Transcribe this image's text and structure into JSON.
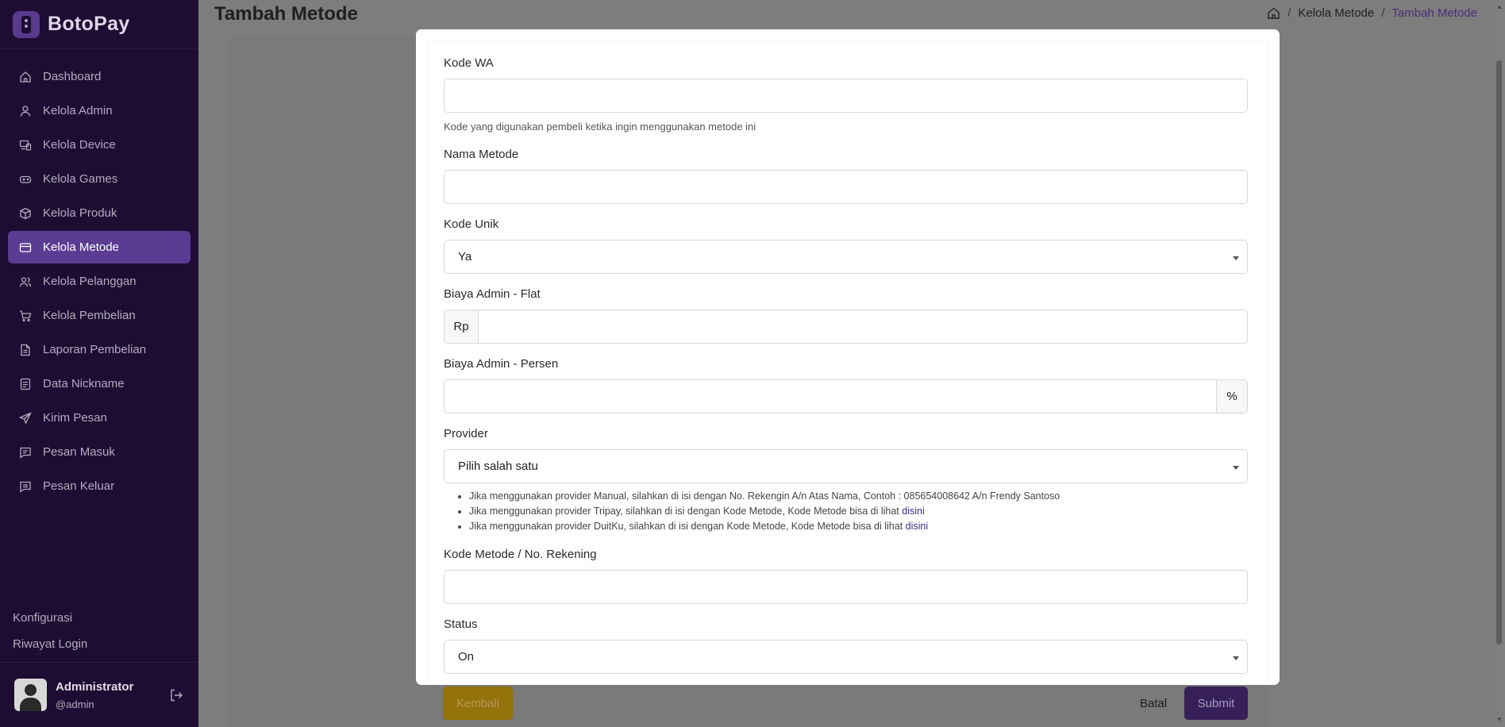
{
  "sidebar": {
    "brand": "BotoPay",
    "items": [
      {
        "label": "Dashboard",
        "icon": "home-icon"
      },
      {
        "label": "Kelola Admin",
        "icon": "user-icon"
      },
      {
        "label": "Kelola Device",
        "icon": "devices-icon"
      },
      {
        "label": "Kelola Games",
        "icon": "gamepad-icon"
      },
      {
        "label": "Kelola Produk",
        "icon": "box-icon"
      },
      {
        "label": "Kelola Metode",
        "icon": "credit-card-icon",
        "active": true
      },
      {
        "label": "Kelola Pelanggan",
        "icon": "users-icon"
      },
      {
        "label": "Kelola Pembelian",
        "icon": "cart-icon"
      },
      {
        "label": "Laporan Pembelian",
        "icon": "file-text-icon"
      },
      {
        "label": "Data Nickname",
        "icon": "database-icon"
      },
      {
        "label": "Kirim Pesan",
        "icon": "send-icon"
      },
      {
        "label": "Pesan Masuk",
        "icon": "message-icon"
      },
      {
        "label": "Pesan Keluar",
        "icon": "message-out-icon"
      }
    ],
    "bottom_links": [
      "Konfigurasi",
      "Riwayat Login"
    ],
    "user": {
      "name": "Administrator",
      "handle": "@admin"
    }
  },
  "header": {
    "title": "Tambah Metode",
    "breadcrumb": [
      "Kelola Metode",
      "Tambah Metode"
    ]
  },
  "form": {
    "kode_wa": {
      "label": "Kode WA",
      "value": "",
      "help": "Kode yang digunakan pembeli ketika ingin menggunakan metode ini"
    },
    "nama_metode": {
      "label": "Nama Metode",
      "value": ""
    },
    "kode_unik": {
      "label": "Kode Unik",
      "selected": "Ya"
    },
    "biaya_flat": {
      "label": "Biaya Admin - Flat",
      "prefix": "Rp",
      "value": ""
    },
    "biaya_persen": {
      "label": "Biaya Admin - Persen",
      "suffix": "%",
      "value": ""
    },
    "provider": {
      "label": "Provider",
      "selected": "Pilih salah satu",
      "notes": [
        {
          "text": "Jika menggunakan provider Manual, silahkan di isi dengan No. Rekengin A/n Atas Nama, Contoh : 085654008642 A/n Frendy Santoso",
          "link": ""
        },
        {
          "text": "Jika menggunakan provider Tripay, silahkan di isi dengan Kode Metode, Kode Metode bisa di lihat ",
          "link": "disini"
        },
        {
          "text": "Jika menggunakan provider DuitKu, silahkan di isi dengan Kode Metode, Kode Metode bisa di lihat ",
          "link": "disini"
        }
      ]
    },
    "kode_metode": {
      "label": "Kode Metode / No. Rekening",
      "value": ""
    },
    "status": {
      "label": "Status",
      "selected": "On"
    }
  },
  "footer": {
    "back_label": "Kembali",
    "cancel_label": "Batal",
    "submit_label": "Submit"
  }
}
